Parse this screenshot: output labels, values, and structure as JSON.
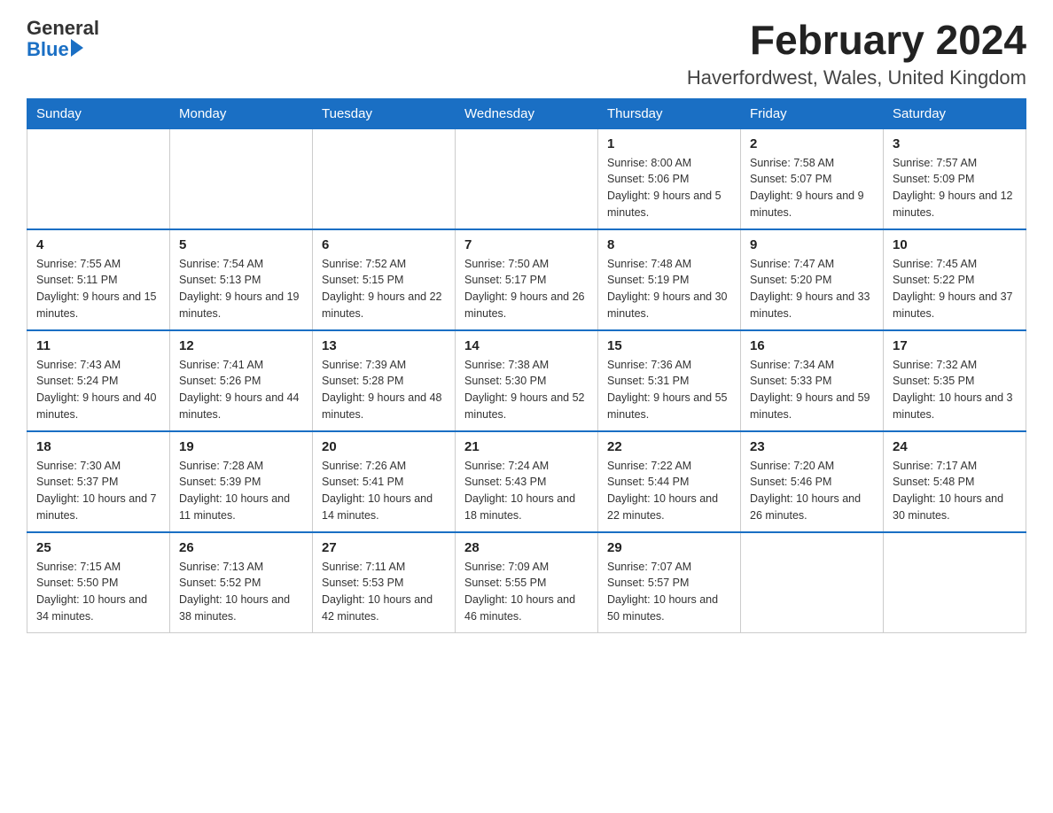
{
  "logo": {
    "general": "General",
    "blue": "Blue"
  },
  "title": "February 2024",
  "subtitle": "Haverfordwest, Wales, United Kingdom",
  "headers": [
    "Sunday",
    "Monday",
    "Tuesday",
    "Wednesday",
    "Thursday",
    "Friday",
    "Saturday"
  ],
  "weeks": [
    [
      {
        "day": "",
        "sunrise": "",
        "sunset": "",
        "daylight": ""
      },
      {
        "day": "",
        "sunrise": "",
        "sunset": "",
        "daylight": ""
      },
      {
        "day": "",
        "sunrise": "",
        "sunset": "",
        "daylight": ""
      },
      {
        "day": "",
        "sunrise": "",
        "sunset": "",
        "daylight": ""
      },
      {
        "day": "1",
        "sunrise": "Sunrise: 8:00 AM",
        "sunset": "Sunset: 5:06 PM",
        "daylight": "Daylight: 9 hours and 5 minutes."
      },
      {
        "day": "2",
        "sunrise": "Sunrise: 7:58 AM",
        "sunset": "Sunset: 5:07 PM",
        "daylight": "Daylight: 9 hours and 9 minutes."
      },
      {
        "day": "3",
        "sunrise": "Sunrise: 7:57 AM",
        "sunset": "Sunset: 5:09 PM",
        "daylight": "Daylight: 9 hours and 12 minutes."
      }
    ],
    [
      {
        "day": "4",
        "sunrise": "Sunrise: 7:55 AM",
        "sunset": "Sunset: 5:11 PM",
        "daylight": "Daylight: 9 hours and 15 minutes."
      },
      {
        "day": "5",
        "sunrise": "Sunrise: 7:54 AM",
        "sunset": "Sunset: 5:13 PM",
        "daylight": "Daylight: 9 hours and 19 minutes."
      },
      {
        "day": "6",
        "sunrise": "Sunrise: 7:52 AM",
        "sunset": "Sunset: 5:15 PM",
        "daylight": "Daylight: 9 hours and 22 minutes."
      },
      {
        "day": "7",
        "sunrise": "Sunrise: 7:50 AM",
        "sunset": "Sunset: 5:17 PM",
        "daylight": "Daylight: 9 hours and 26 minutes."
      },
      {
        "day": "8",
        "sunrise": "Sunrise: 7:48 AM",
        "sunset": "Sunset: 5:19 PM",
        "daylight": "Daylight: 9 hours and 30 minutes."
      },
      {
        "day": "9",
        "sunrise": "Sunrise: 7:47 AM",
        "sunset": "Sunset: 5:20 PM",
        "daylight": "Daylight: 9 hours and 33 minutes."
      },
      {
        "day": "10",
        "sunrise": "Sunrise: 7:45 AM",
        "sunset": "Sunset: 5:22 PM",
        "daylight": "Daylight: 9 hours and 37 minutes."
      }
    ],
    [
      {
        "day": "11",
        "sunrise": "Sunrise: 7:43 AM",
        "sunset": "Sunset: 5:24 PM",
        "daylight": "Daylight: 9 hours and 40 minutes."
      },
      {
        "day": "12",
        "sunrise": "Sunrise: 7:41 AM",
        "sunset": "Sunset: 5:26 PM",
        "daylight": "Daylight: 9 hours and 44 minutes."
      },
      {
        "day": "13",
        "sunrise": "Sunrise: 7:39 AM",
        "sunset": "Sunset: 5:28 PM",
        "daylight": "Daylight: 9 hours and 48 minutes."
      },
      {
        "day": "14",
        "sunrise": "Sunrise: 7:38 AM",
        "sunset": "Sunset: 5:30 PM",
        "daylight": "Daylight: 9 hours and 52 minutes."
      },
      {
        "day": "15",
        "sunrise": "Sunrise: 7:36 AM",
        "sunset": "Sunset: 5:31 PM",
        "daylight": "Daylight: 9 hours and 55 minutes."
      },
      {
        "day": "16",
        "sunrise": "Sunrise: 7:34 AM",
        "sunset": "Sunset: 5:33 PM",
        "daylight": "Daylight: 9 hours and 59 minutes."
      },
      {
        "day": "17",
        "sunrise": "Sunrise: 7:32 AM",
        "sunset": "Sunset: 5:35 PM",
        "daylight": "Daylight: 10 hours and 3 minutes."
      }
    ],
    [
      {
        "day": "18",
        "sunrise": "Sunrise: 7:30 AM",
        "sunset": "Sunset: 5:37 PM",
        "daylight": "Daylight: 10 hours and 7 minutes."
      },
      {
        "day": "19",
        "sunrise": "Sunrise: 7:28 AM",
        "sunset": "Sunset: 5:39 PM",
        "daylight": "Daylight: 10 hours and 11 minutes."
      },
      {
        "day": "20",
        "sunrise": "Sunrise: 7:26 AM",
        "sunset": "Sunset: 5:41 PM",
        "daylight": "Daylight: 10 hours and 14 minutes."
      },
      {
        "day": "21",
        "sunrise": "Sunrise: 7:24 AM",
        "sunset": "Sunset: 5:43 PM",
        "daylight": "Daylight: 10 hours and 18 minutes."
      },
      {
        "day": "22",
        "sunrise": "Sunrise: 7:22 AM",
        "sunset": "Sunset: 5:44 PM",
        "daylight": "Daylight: 10 hours and 22 minutes."
      },
      {
        "day": "23",
        "sunrise": "Sunrise: 7:20 AM",
        "sunset": "Sunset: 5:46 PM",
        "daylight": "Daylight: 10 hours and 26 minutes."
      },
      {
        "day": "24",
        "sunrise": "Sunrise: 7:17 AM",
        "sunset": "Sunset: 5:48 PM",
        "daylight": "Daylight: 10 hours and 30 minutes."
      }
    ],
    [
      {
        "day": "25",
        "sunrise": "Sunrise: 7:15 AM",
        "sunset": "Sunset: 5:50 PM",
        "daylight": "Daylight: 10 hours and 34 minutes."
      },
      {
        "day": "26",
        "sunrise": "Sunrise: 7:13 AM",
        "sunset": "Sunset: 5:52 PM",
        "daylight": "Daylight: 10 hours and 38 minutes."
      },
      {
        "day": "27",
        "sunrise": "Sunrise: 7:11 AM",
        "sunset": "Sunset: 5:53 PM",
        "daylight": "Daylight: 10 hours and 42 minutes."
      },
      {
        "day": "28",
        "sunrise": "Sunrise: 7:09 AM",
        "sunset": "Sunset: 5:55 PM",
        "daylight": "Daylight: 10 hours and 46 minutes."
      },
      {
        "day": "29",
        "sunrise": "Sunrise: 7:07 AM",
        "sunset": "Sunset: 5:57 PM",
        "daylight": "Daylight: 10 hours and 50 minutes."
      },
      {
        "day": "",
        "sunrise": "",
        "sunset": "",
        "daylight": ""
      },
      {
        "day": "",
        "sunrise": "",
        "sunset": "",
        "daylight": ""
      }
    ]
  ]
}
